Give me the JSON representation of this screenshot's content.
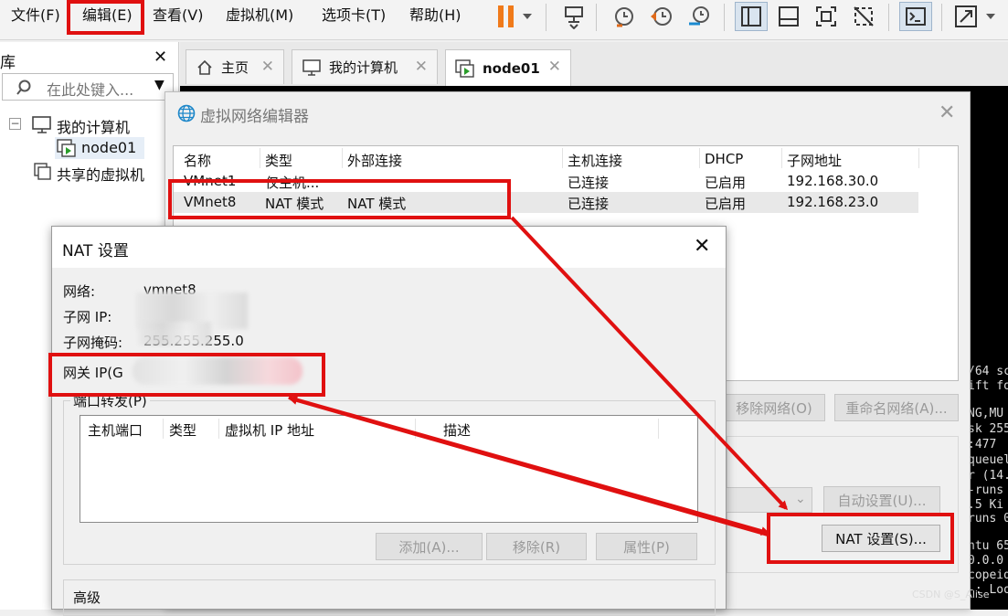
{
  "menubar": {
    "items": [
      "文件(F)",
      "编辑(E)",
      "查看(V)",
      "虚拟机(M)",
      "选项卡(T)",
      "帮助(H)"
    ]
  },
  "library": {
    "title": "库",
    "search_placeholder": "在此处键入...",
    "tree": [
      "我的计算机",
      "node01",
      "共享的虚拟机"
    ]
  },
  "tabs": [
    "主页",
    "我的计算机",
    "node01"
  ],
  "console_lines": [
    "/64 sc",
    "ift fo",
    "NG,MU",
    "sk 255",
    ":477",
    "queuel",
    "r (14.6",
    "-runs",
    ".5 Ki",
    "runs 0",
    "ntu 65",
    "0.0.0",
    "copeid",
    "-: Loo"
  ],
  "vnet_editor": {
    "title": "虚拟网络编辑器",
    "columns": [
      "名称",
      "类型",
      "外部连接",
      "主机连接",
      "DHCP",
      "子网地址"
    ],
    "rows": [
      [
        "VMnet1",
        "仅主机...",
        "",
        "已连接",
        "已启用",
        "192.168.30.0"
      ],
      [
        "VMnet8",
        "NAT 模式",
        "NAT 模式",
        "已连接",
        "已启用",
        "192.168.23.0"
      ]
    ],
    "remove_network": "移除网络(O)",
    "rename_network": "重命名网络(A)...",
    "auto_settings": "自动设置(U)...",
    "nat_settings": "NAT 设置(S)..."
  },
  "nat_dialog": {
    "title": "NAT 设置",
    "network_label": "网络:",
    "network_value": "vmnet8",
    "subnet_ip_label": "子网 IP:",
    "subnet_mask_label": "子网掩码:",
    "subnet_mask_value": "255.255.255.0",
    "gateway_label": "网关 IP(G",
    "port_forward_label": "端口转发(P)",
    "pf_columns": [
      "主机端口",
      "类型",
      "虚拟机 IP 地址",
      "描述"
    ],
    "add": "添加(A)...",
    "remove": "移除(R)",
    "properties": "属性(P)",
    "advanced": "高级"
  },
  "watermark": "CSDN @S_Alise"
}
